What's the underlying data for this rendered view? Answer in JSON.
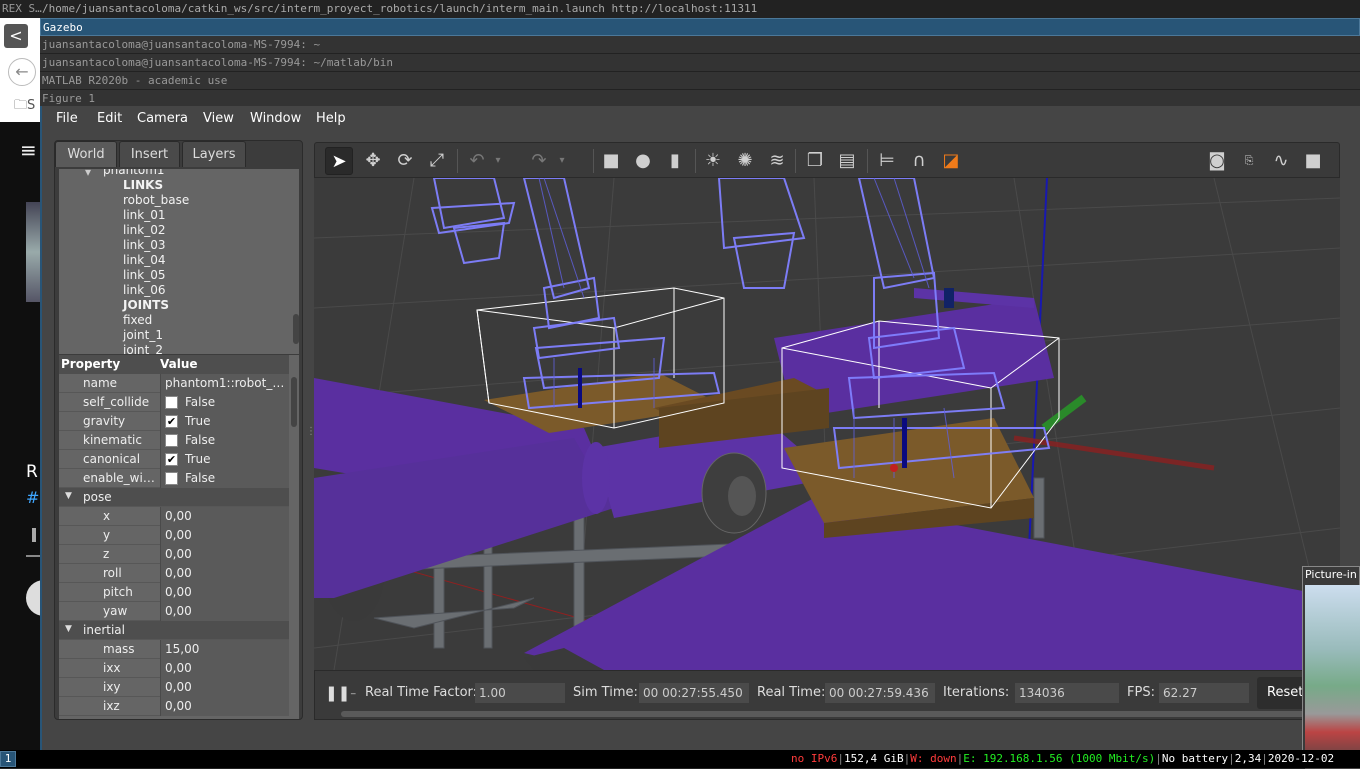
{
  "titlebars": {
    "top_left": "REX S…",
    "top": "/home/juansantacoloma/catkin_ws/src/interm_proyect_robotics/launch/interm_main.launch http://localhost:11311",
    "active": "Gazebo",
    "stack": [
      "juansantacoloma@juansantacoloma-MS-7994: ~",
      "juansantacoloma@juansantacoloma-MS-7994: ~/matlab/bin",
      "MATLAB R2020b - academic use",
      "Figure 1"
    ]
  },
  "background_app": {
    "back": "<",
    "folder": "S",
    "menu": "≡",
    "r": "R",
    "hash": "#"
  },
  "menu": [
    "File",
    "Edit",
    "Camera",
    "View",
    "Window",
    "Help"
  ],
  "tabs": [
    "World",
    "Insert",
    "Layers"
  ],
  "tree": {
    "model": "phantom1",
    "links_header": "LINKS",
    "links": [
      "robot_base",
      "link_01",
      "link_02",
      "link_03",
      "link_04",
      "link_05",
      "link_06"
    ],
    "joints_header": "JOINTS",
    "joints": [
      "fixed",
      "joint_1",
      "joint_2"
    ]
  },
  "properties": {
    "header_property": "Property",
    "header_value": "Value",
    "rows": [
      {
        "key": "name",
        "value": "phantom1::robot_…"
      },
      {
        "key": "self_collide",
        "check": false,
        "value": "False"
      },
      {
        "key": "gravity",
        "check": true,
        "value": "True"
      },
      {
        "key": "kinematic",
        "check": false,
        "value": "False"
      },
      {
        "key": "canonical",
        "check": true,
        "value": "True"
      },
      {
        "key": "enable_wi…",
        "check": false,
        "value": "False"
      }
    ],
    "pose_label": "pose",
    "pose": [
      {
        "key": "x",
        "value": "0,00"
      },
      {
        "key": "y",
        "value": "0,00"
      },
      {
        "key": "z",
        "value": "0,00"
      },
      {
        "key": "roll",
        "value": "0,00"
      },
      {
        "key": "pitch",
        "value": "0,00"
      },
      {
        "key": "yaw",
        "value": "0,00"
      }
    ],
    "inertial_label": "inertial",
    "inertial": [
      {
        "key": "mass",
        "value": "15,00"
      },
      {
        "key": "ixx",
        "value": "0,00"
      },
      {
        "key": "ixy",
        "value": "0,00"
      },
      {
        "key": "ixz",
        "value": "0,00"
      }
    ]
  },
  "bottombar": {
    "rtf_label": "Real Time Factor:",
    "rtf": "1.00",
    "sim_label": "Sim Time:",
    "sim": "00 00:27:55.450",
    "real_label": "Real Time:",
    "real": "00 00:27:59.436",
    "iter_label": "Iterations:",
    "iter": "134036",
    "fps_label": "FPS:",
    "fps": "62.27",
    "reset": "Reset"
  },
  "pip": {
    "title": "Picture-in"
  },
  "statusbar": {
    "workspace": "1",
    "ipv6": "no IPv6",
    "disk": "152,4 GiB",
    "wifi": "W: down",
    "eth": "E: 192.168.1.56 (1000 Mbit/s)",
    "battery": "No battery",
    "load": "2,34",
    "date": "2020-12-02"
  },
  "colors": {
    "accent": "#285577",
    "conveyor": "#5a2fa0",
    "wireframe": "#7b7bff"
  }
}
